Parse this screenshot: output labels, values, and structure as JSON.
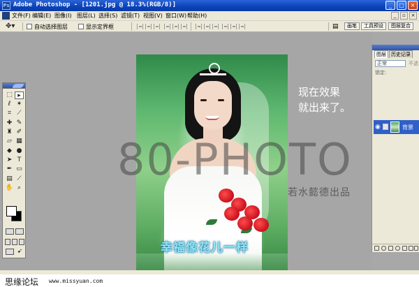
{
  "window": {
    "title": "Adobe Photoshop - [1201.jpg @ 18.3%(RGB/8)]",
    "app_icon": "photoshop-icon",
    "controls": [
      "minimize",
      "maximize",
      "close"
    ]
  },
  "menubar": {
    "items": [
      "文件(F)",
      "编辑(E)",
      "图像(I)",
      "图层(L)",
      "选择(S)",
      "滤镜(T)",
      "视图(V)",
      "窗口(W)",
      "帮助(H)"
    ]
  },
  "options": {
    "auto_select_label": "自动选择图层",
    "show_bounds_label": "显示定界框",
    "palette_tabs": [
      "画笔",
      "工具预设",
      "图层复合"
    ]
  },
  "canvas": {
    "banner_text": "幸福像花儿一样",
    "note_text": "现在效果\n就出来了。",
    "watermark": "80-PHOTO",
    "credit": "若水懿德出品"
  },
  "layers_panel": {
    "tabs": [
      "图层",
      "历史记录"
    ],
    "blend_mode": "正常",
    "opacity_label": "不透",
    "lock_label": "锁定:",
    "layer_name": "背景"
  },
  "footer": {
    "forum_name": "思缘论坛",
    "site_url": "www.missyuan.com"
  },
  "colors": {
    "titlebar": "#0a42b8",
    "chrome": "#ece9d8",
    "workspace": "#a6a6a6",
    "layer_selected": "#2f5fc8"
  }
}
